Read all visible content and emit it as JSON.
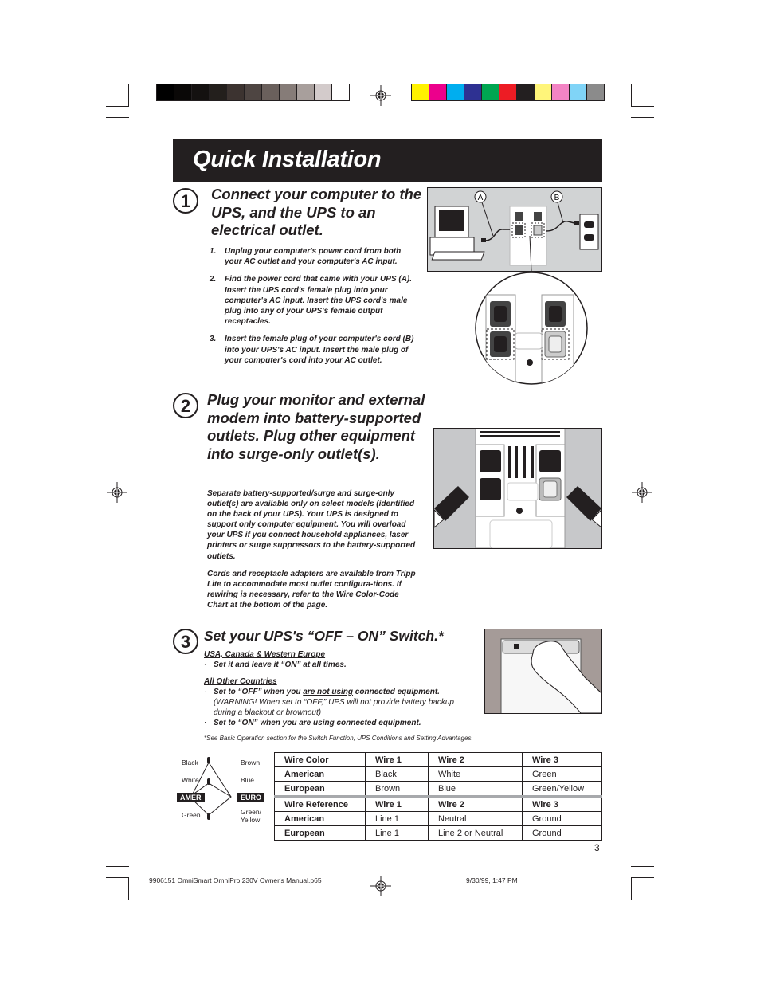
{
  "page": {
    "title": "Quick Installation",
    "page_number": "3",
    "footer_file": "9906151 OmniSmart OmniPro 230V Owner's Manual.p65",
    "footer_page_overprint": "3",
    "footer_date": "9/30/99, 1:47 PM"
  },
  "print_marks": {
    "gray_bar": [
      "#000000",
      "#0a0807",
      "#141110",
      "#231f1c",
      "#3c3330",
      "#4e4542",
      "#6a605c",
      "#867c78",
      "#a89f9c",
      "#d3cbcb",
      "#ffffff"
    ],
    "color_bar": [
      "#fff200",
      "#ec008c",
      "#00aeef",
      "#2e3192",
      "#00a651",
      "#ed1c24",
      "#231f20",
      "#fff57a",
      "#f384c4",
      "#80d4f7",
      "#8b8b8b"
    ]
  },
  "step1": {
    "number": "1",
    "heading": "Connect your computer to the UPS, and the UPS to an electrical outlet.",
    "items": [
      {
        "n": "1.",
        "text": "Unplug your computer's power cord from both your AC outlet and your computer's AC input."
      },
      {
        "n": "2.",
        "text": "Find the power cord that came with your UPS (A). Insert the UPS cord's female plug into your computer's AC input. Insert the UPS cord's male plug into any of your UPS's female output receptacles."
      },
      {
        "n": "3.",
        "text": "Insert the female plug of your computer's cord (B) into your UPS's AC input. Insert the male plug of your computer's cord into your AC outlet."
      }
    ],
    "figure": {
      "label_a": "A",
      "label_b": "B"
    }
  },
  "step2": {
    "number": "2",
    "heading": "Plug your monitor and external modem into battery-supported outlets. Plug other equipment into surge-only outlet(s).",
    "para1": "Separate battery-supported/surge and surge-only outlet(s) are available only on select models (identified on the back of your UPS). Your UPS is designed to support only computer equipment.  You will overload your UPS if you connect household appliances, laser printers or surge suppressors to the battery-supported outlets.",
    "para2": "Cords and receptacle adapters are available from Tripp Lite to accommodate most outlet configura-tions. If rewiring is necessary, refer to the Wire Color-Code Chart at the bottom of the page."
  },
  "step3": {
    "number": "3",
    "heading": "Set your UPS's “OFF – ON” Switch.*",
    "region1": "USA, Canada & Western Europe",
    "region1_item": "Set it and leave it “ON” at all times.",
    "region2": "All Other Countries",
    "region2_item1_pre": "Set to “OFF” when you ",
    "region2_item1_u": "are not using",
    "region2_item1_post": " connected equipment.",
    "region2_warning": "(WARNING! When set to “OFF,” UPS  will not provide battery backup during a blackout or  brownout)",
    "region2_item2": "Set to “ON” when you are using connected equipment.",
    "bullet": "·",
    "footnote": "*See Basic Operation section for the Switch Function, UPS Conditions and Setting Advantages."
  },
  "wire_legend": {
    "black": "Black",
    "white": "White",
    "green": "Green",
    "brown": "Brown",
    "blue": "Blue",
    "green_yellow_1": "Green/",
    "green_yellow_2": "Yellow",
    "amer": "AMER",
    "euro": "EURO"
  },
  "wire_table": {
    "rows": [
      {
        "c0": "Wire Color",
        "c1": "Wire 1",
        "c2": "Wire 2",
        "c3": "Wire 3",
        "header": true
      },
      {
        "c0": "American",
        "c1": "Black",
        "c2": "White",
        "c3": "Green"
      },
      {
        "c0": "European",
        "c1": "Brown",
        "c2": "Blue",
        "c3": "Green/Yellow"
      },
      {
        "c0": "Wire Reference",
        "c1": "Wire 1",
        "c2": "Wire 2",
        "c3": "Wire 3",
        "header": true
      },
      {
        "c0": "American",
        "c1": "Line 1",
        "c2": "Neutral",
        "c3": "Ground"
      },
      {
        "c0": "European",
        "c1": "Line 1",
        "c2": "Line 2 or Neutral",
        "c3": "Ground"
      }
    ]
  }
}
